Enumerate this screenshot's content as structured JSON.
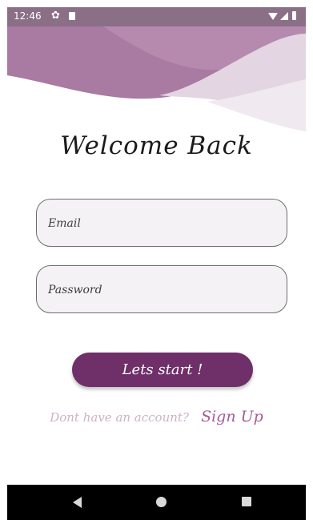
{
  "status_bar": {
    "time": "12:46",
    "icons": [
      "gear-icon",
      "sd-card-icon",
      "wifi-icon",
      "signal-icon",
      "battery-icon"
    ]
  },
  "login": {
    "title": "Welcome Back",
    "email_placeholder": "Email",
    "email_value": "",
    "password_placeholder": "Password",
    "password_value": "",
    "start_button_label": "Lets start !",
    "signup_prompt": "Dont have an account?",
    "signup_link_label": "Sign Up"
  },
  "nav_bar": {
    "icons": [
      "back-icon",
      "home-icon",
      "recents-icon"
    ]
  },
  "colors": {
    "accent": "#6f2f68",
    "signup_link": "#a55c99",
    "signup_prompt": "#cdb2c8",
    "status_bar": "#8a6f86",
    "field_background": "#f4f2f4"
  }
}
